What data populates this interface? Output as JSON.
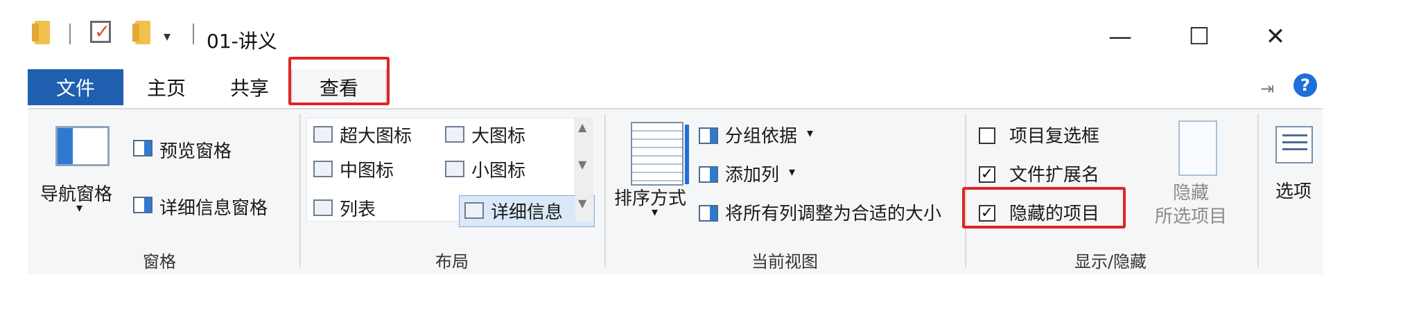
{
  "window": {
    "title": "01-讲义",
    "controls": {
      "minimize": "—",
      "maximize": "☐",
      "close": "✕"
    }
  },
  "quick_access": {
    "dropdown": "▾"
  },
  "tabs": [
    {
      "label": "文件"
    },
    {
      "label": "主页"
    },
    {
      "label": "共享"
    },
    {
      "label": "查看"
    }
  ],
  "ribbon": {
    "pane_group": {
      "label": "窗格",
      "navigation_pane": "导航窗格",
      "preview_pane": "预览窗格",
      "details_pane": "详细信息窗格"
    },
    "layout_group": {
      "label": "布局",
      "items": [
        "超大图标",
        "大图标",
        "中图标",
        "小图标",
        "列表",
        "详细信息"
      ],
      "selected": "详细信息"
    },
    "current_view_group": {
      "label": "当前视图",
      "sort_by": "排序方式",
      "group_by": "分组依据",
      "add_columns": "添加列",
      "size_all_columns": "将所有列调整为合适的大小"
    },
    "show_hide_group": {
      "label": "显示/隐藏",
      "item_checkboxes": {
        "label": "项目复选框",
        "checked": false
      },
      "file_name_extensions": {
        "label": "文件扩展名",
        "checked": true
      },
      "hidden_items": {
        "label": "隐藏的项目",
        "checked": true
      },
      "hide_selected_1": "隐藏",
      "hide_selected_2": "所选项目"
    },
    "options": {
      "label": "选项"
    }
  },
  "highlight_color": "#e02424",
  "accent_color": "#1f5fb0"
}
